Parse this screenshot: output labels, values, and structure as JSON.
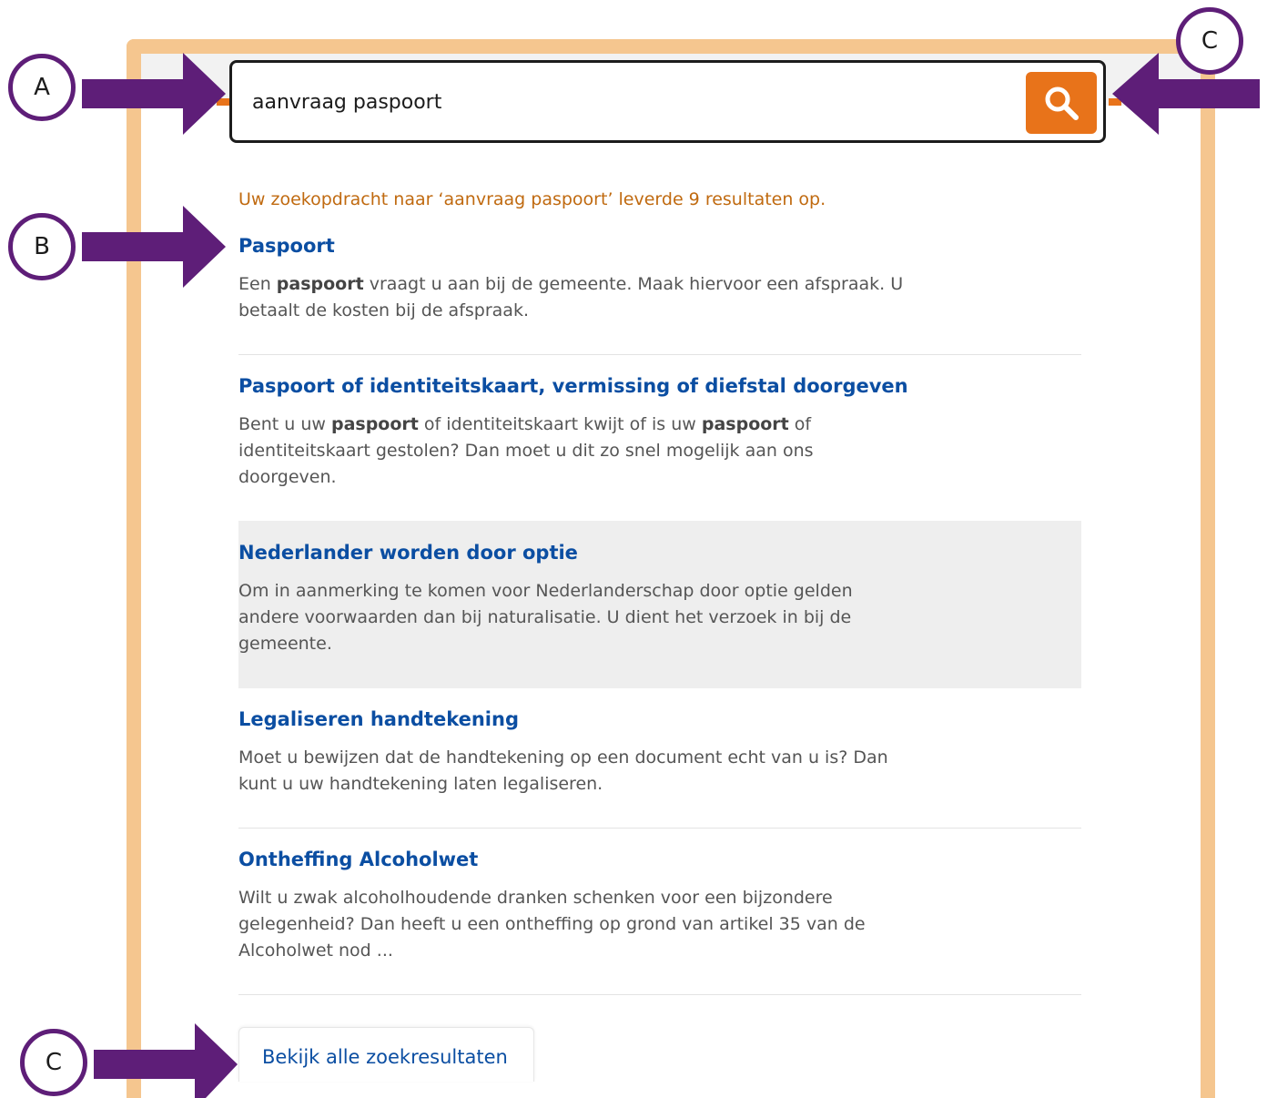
{
  "search": {
    "value": "aanvraag paspoort",
    "button_icon": "search-icon"
  },
  "summary": "Uw zoekopdracht naar ‘aanvraag paspoort’ leverde 9 resultaten op.",
  "results": [
    {
      "title": "Paspoort",
      "desc": [
        {
          "t": "Een "
        },
        {
          "t": "paspoort",
          "b": true
        },
        {
          "t": " vraagt u aan bij de gemeente. Maak hiervoor een afspraak. U betaalt de kosten bij de afspraak."
        }
      ]
    },
    {
      "title": "Paspoort of identiteitskaart, vermissing of diefstal doorgeven",
      "desc": [
        {
          "t": "Bent u uw "
        },
        {
          "t": "paspoort",
          "b": true
        },
        {
          "t": " of identiteitskaart kwijt of is uw "
        },
        {
          "t": "paspoort",
          "b": true
        },
        {
          "t": " of identiteitskaart gestolen? Dan moet u dit zo snel mogelijk aan ons doorgeven."
        }
      ]
    },
    {
      "title": "Nederlander worden door optie",
      "desc": [
        {
          "t": "Om in aanmerking te komen voor Nederlanderschap door optie gelden andere voorwaarden dan bij naturalisatie. U dient het verzoek in bij de gemeente."
        }
      ]
    },
    {
      "title": "Legaliseren handtekening",
      "desc": [
        {
          "t": "Moet u bewijzen dat de handtekening op een document echt van u is? Dan kunt u uw handtekening laten legaliseren."
        }
      ]
    },
    {
      "title": "Ontheffing Alcoholwet",
      "desc": [
        {
          "t": "Wilt u zwak alcoholhoudende dranken schenken voor een bijzondere gelegenheid? Dan heeft u een ontheffing op grond van artikel 35 van de Alcoholwet nod ..."
        }
      ]
    }
  ],
  "all_results_label": "Bekijk alle zoekresultaten",
  "callouts": {
    "a": "A",
    "b": "B",
    "c_top": "C",
    "c_bottom": "C"
  },
  "colors": {
    "frame": "#f5c68f",
    "accent": "#e8731a",
    "link": "#0b4ea2",
    "summary": "#c06a10",
    "callout": "#5e1e78"
  }
}
